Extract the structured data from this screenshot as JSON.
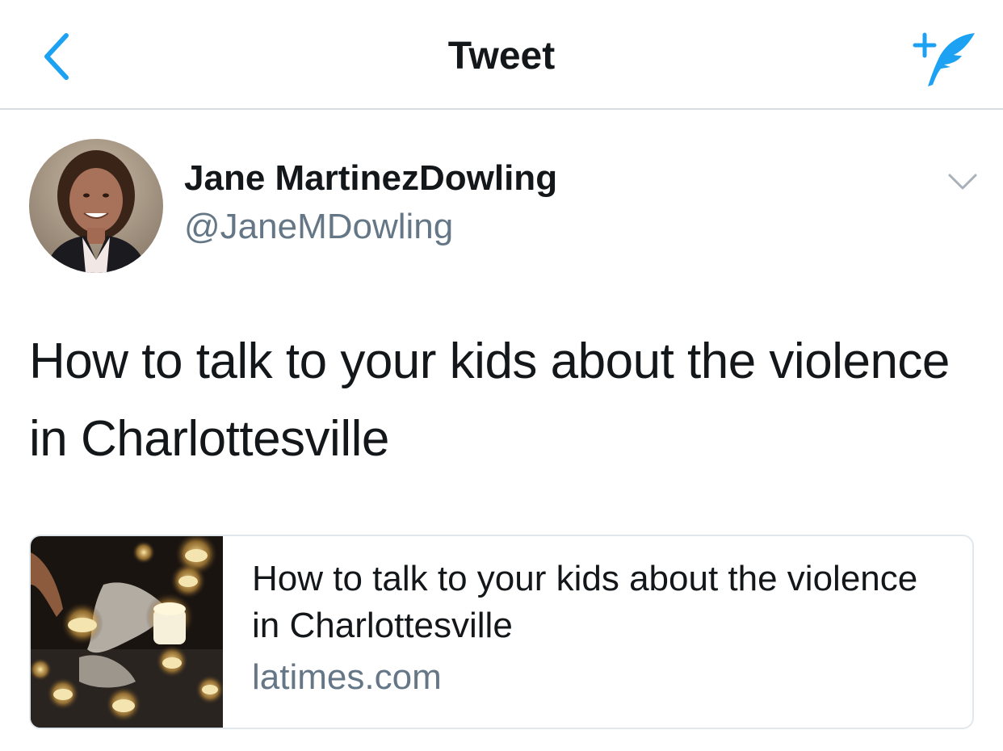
{
  "nav": {
    "title": "Tweet",
    "back_icon": "chevron-left-icon",
    "compose_icon": "compose-tweet-icon",
    "accent_color": "#1da1f2"
  },
  "tweet": {
    "author": {
      "display_name": "Jane MartinezDowling",
      "handle": "@JaneMDowling",
      "avatar_icon": "avatar"
    },
    "menu_icon": "chevron-down-icon",
    "text": "How to talk to your kids about the violence in Charlottesville",
    "card": {
      "title": "How to talk to your kids about the violence in Charlottesville",
      "domain": "latimes.com",
      "thumbnail": "candles-image"
    }
  },
  "colors": {
    "text_primary": "#14171a",
    "text_secondary": "#657786",
    "divider": "#d8dde1"
  }
}
